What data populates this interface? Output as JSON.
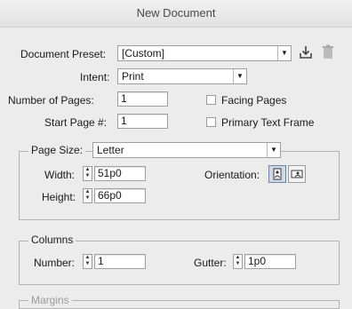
{
  "window": {
    "title": "New Document"
  },
  "preset": {
    "label": "Document Preset:",
    "value": "[Custom]",
    "save_icon": "save-preset-icon",
    "delete_icon": "trash-icon"
  },
  "intent": {
    "label": "Intent:",
    "value": "Print"
  },
  "pages": {
    "label": "Number of Pages:",
    "value": "1"
  },
  "start_page": {
    "label": "Start Page #:",
    "value": "1"
  },
  "facing_pages": {
    "label": "Facing Pages",
    "checked": false
  },
  "primary_text_frame": {
    "label": "Primary Text Frame",
    "checked": false
  },
  "page_size": {
    "label": "Page Size:",
    "value": "Letter",
    "width_label": "Width:",
    "width_value": "51p0",
    "height_label": "Height:",
    "height_value": "66p0",
    "orientation_label": "Orientation:",
    "orientation": "portrait"
  },
  "columns": {
    "legend": "Columns",
    "number_label": "Number:",
    "number_value": "1",
    "gutter_label": "Gutter:",
    "gutter_value": "1p0"
  },
  "margins": {
    "legend": "Margins"
  }
}
